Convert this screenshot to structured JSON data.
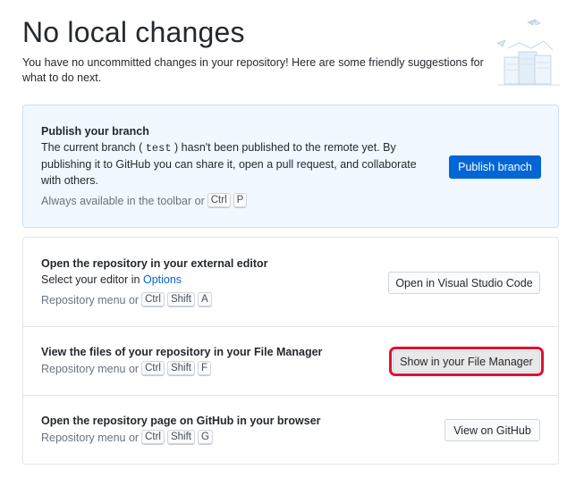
{
  "header": {
    "title": "No local changes",
    "subtitle": "You have no uncommitted changes in your repository! Here are some friendly suggestions for what to do next."
  },
  "publish": {
    "title": "Publish your branch",
    "desc_before": "The current branch (",
    "branch": "test",
    "desc_after": ") hasn't been published to the remote yet. By publishing it to GitHub you can share it, open a pull request, and collaborate with others.",
    "hint": "Always available in the toolbar or",
    "keys": [
      "Ctrl",
      "P"
    ],
    "button": "Publish branch"
  },
  "editor": {
    "title": "Open the repository in your external editor",
    "desc": "Select your editor in",
    "link": "Options",
    "hint": "Repository menu or",
    "keys": [
      "Ctrl",
      "Shift",
      "A"
    ],
    "button": "Open in Visual Studio Code"
  },
  "files": {
    "title": "View the files of your repository in your File Manager",
    "hint": "Repository menu or",
    "keys": [
      "Ctrl",
      "Shift",
      "F"
    ],
    "button": "Show in your File Manager"
  },
  "github": {
    "title": "Open the repository page on GitHub in your browser",
    "hint": "Repository menu or",
    "keys": [
      "Ctrl",
      "Shift",
      "G"
    ],
    "button": "View on GitHub"
  },
  "colors": {
    "accent": "#0366d6",
    "highlight_border": "#e0102f",
    "publish_bg": "#f1f8ff"
  }
}
